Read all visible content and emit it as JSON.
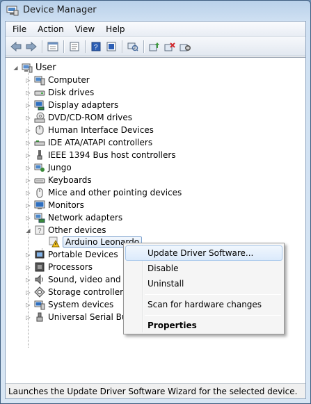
{
  "window": {
    "title": "Device Manager"
  },
  "menu": [
    "File",
    "Action",
    "View",
    "Help"
  ],
  "toolbar": {
    "icons": [
      "back-icon",
      "forward-icon",
      "up-icon",
      "properties-icon",
      "help-icon",
      "show-hide-icon",
      "scan-icon",
      "update-driver-icon",
      "uninstall-icon",
      "disable-icon"
    ]
  },
  "tree": {
    "root": "User",
    "categories": [
      {
        "label": "Computer",
        "icon": "computer-icon"
      },
      {
        "label": "Disk drives",
        "icon": "disk-drive-icon"
      },
      {
        "label": "Display adapters",
        "icon": "display-adapter-icon"
      },
      {
        "label": "DVD/CD-ROM drives",
        "icon": "dvd-icon"
      },
      {
        "label": "Human Interface Devices",
        "icon": "hid-icon"
      },
      {
        "label": "IDE ATA/ATAPI controllers",
        "icon": "ide-icon"
      },
      {
        "label": "IEEE 1394 Bus host controllers",
        "icon": "firewire-icon"
      },
      {
        "label": "Jungo",
        "icon": "jungo-icon"
      },
      {
        "label": "Keyboards",
        "icon": "keyboard-icon"
      },
      {
        "label": "Mice and other pointing devices",
        "icon": "mouse-icon"
      },
      {
        "label": "Monitors",
        "icon": "monitor-icon"
      },
      {
        "label": "Network adapters",
        "icon": "network-adapter-icon"
      },
      {
        "label": "Other devices",
        "icon": "other-devices-icon"
      },
      {
        "label": "Arduino Leonardo",
        "icon": "unknown-device-warning-icon"
      },
      {
        "label": "Portable Devices",
        "icon": "portable-device-icon"
      },
      {
        "label": "Processors",
        "icon": "processor-icon"
      },
      {
        "label": "Sound, video and ga",
        "icon": "sound-icon"
      },
      {
        "label": "Storage controllers",
        "icon": "storage-controller-icon"
      },
      {
        "label": "System devices",
        "icon": "system-devices-icon"
      },
      {
        "label": "Universal Serial Bus",
        "icon": "usb-icon"
      }
    ]
  },
  "context_menu": {
    "items": [
      "Update Driver Software...",
      "Disable",
      "Uninstall",
      "Scan for hardware changes",
      "Properties"
    ]
  },
  "status": "Launches the Update Driver Software Wizard for the selected device."
}
